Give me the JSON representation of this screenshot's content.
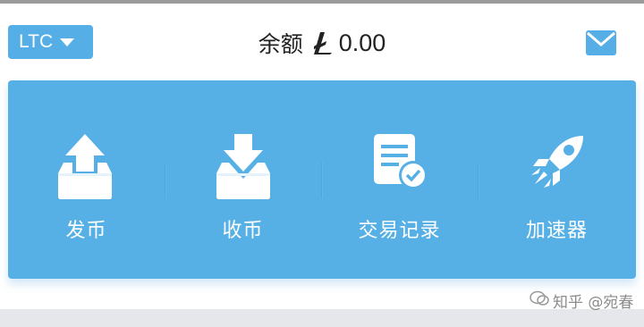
{
  "header": {
    "currency_selector": {
      "label": "LTC"
    },
    "balance_label": "余额",
    "balance_amount": "0.00"
  },
  "actions": [
    {
      "label": "发币",
      "icon": "upload-tray-icon"
    },
    {
      "label": "收币",
      "icon": "download-tray-icon"
    },
    {
      "label": "交易记录",
      "icon": "transaction-record-icon"
    },
    {
      "label": "加速器",
      "icon": "rocket-icon"
    }
  ],
  "watermark": {
    "text": "知乎 @宛春"
  },
  "colors": {
    "accent": "#55aee6",
    "panel": "#56b0e6",
    "text": "#222222",
    "white": "#ffffff"
  }
}
